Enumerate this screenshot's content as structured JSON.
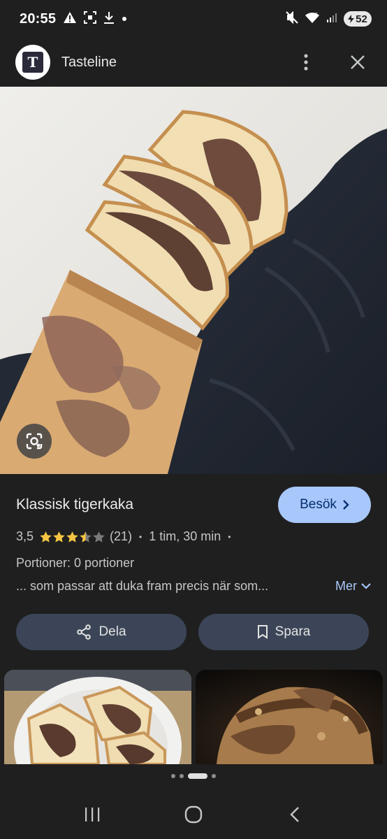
{
  "status_bar": {
    "time": "20:55",
    "battery": "52",
    "icons": [
      "warning-icon",
      "screenshot-icon",
      "download-icon",
      "dot-icon",
      "mute-icon",
      "wifi-icon",
      "signal-icon",
      "battery-icon"
    ]
  },
  "header": {
    "logo_letter": "T",
    "site_name": "Tasteline",
    "icons": [
      "more-vert-icon",
      "close-icon"
    ]
  },
  "recipe": {
    "title": "Klassisk tigerkaka",
    "visit_label": "Besök",
    "rating": "3,5",
    "rating_value": 3.5,
    "rating_max": 5,
    "review_count": "(21)",
    "time": "1 tim, 30 min",
    "servings": "Portioner: 0 portioner",
    "snippet": "... som passar att duka fram precis när som...",
    "more_label": "Mer"
  },
  "actions": {
    "share_label": "Dela",
    "save_label": "Spara"
  },
  "thumbnails": [
    {
      "name": "marble-cake-slices-photo"
    },
    {
      "name": "chocolate-cake-photo"
    }
  ],
  "pager": {
    "count": 4,
    "active": 2
  },
  "colors": {
    "background": "#1f1f1f",
    "accent": "#a8c7fa",
    "button_bg": "#3b4557",
    "star": "#f5c542"
  }
}
